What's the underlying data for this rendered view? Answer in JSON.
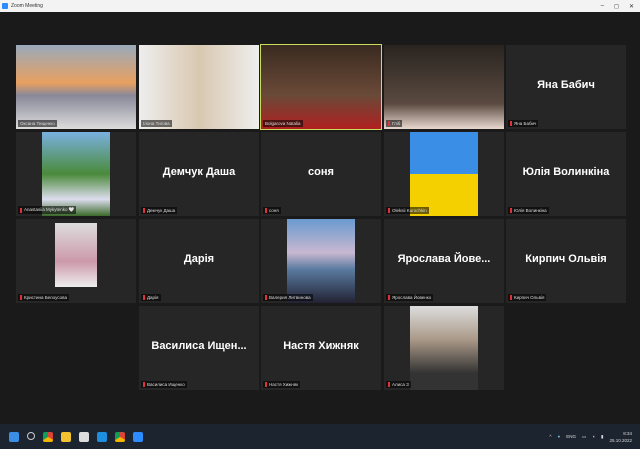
{
  "window": {
    "title": "Zoom Meeting",
    "minimize": "–",
    "maximize": "◻",
    "close": "✕"
  },
  "participants": [
    {
      "name": "Оксана Тищенко",
      "video": true
    },
    {
      "name": "Ілона Тигова",
      "video": true
    },
    {
      "name": "Bolgarova Natalia",
      "video": true,
      "active": true
    },
    {
      "name": "Гліб",
      "video": true
    },
    {
      "name": "Яна Бабич",
      "display": "Яна Бабич"
    },
    {
      "name": "Anastasiia Mykytenko 🤍",
      "video": true
    },
    {
      "name": "Демчук Даша",
      "display": "Демчук Даша"
    },
    {
      "name": "соня",
      "display": "соня"
    },
    {
      "name": "Oleksii Kurochkin",
      "video": true
    },
    {
      "name": "Юлія Волинкіна",
      "display": "Юлія Волинкіна"
    },
    {
      "name": "Кристина Белоусова",
      "video": true
    },
    {
      "name": "Дарія",
      "display": "Дарія"
    },
    {
      "name": "Валерия Литвинова",
      "video": true
    },
    {
      "name": "Ярослава Йовенко",
      "display": "Ярослава  Йове..."
    },
    {
      "name": "Кирпич Ольвія",
      "display": "Кирпич Ольвія"
    },
    {
      "name": "Василиса Ищенко",
      "display": "Василиса  Ищен..."
    },
    {
      "name": "Настя Хижняк",
      "display": "Настя Хижняк"
    },
    {
      "name": "Алиса З",
      "video": true
    }
  ],
  "taskbar": {
    "lang": "ENG",
    "time": "8:34",
    "date": "25.10.2022"
  }
}
